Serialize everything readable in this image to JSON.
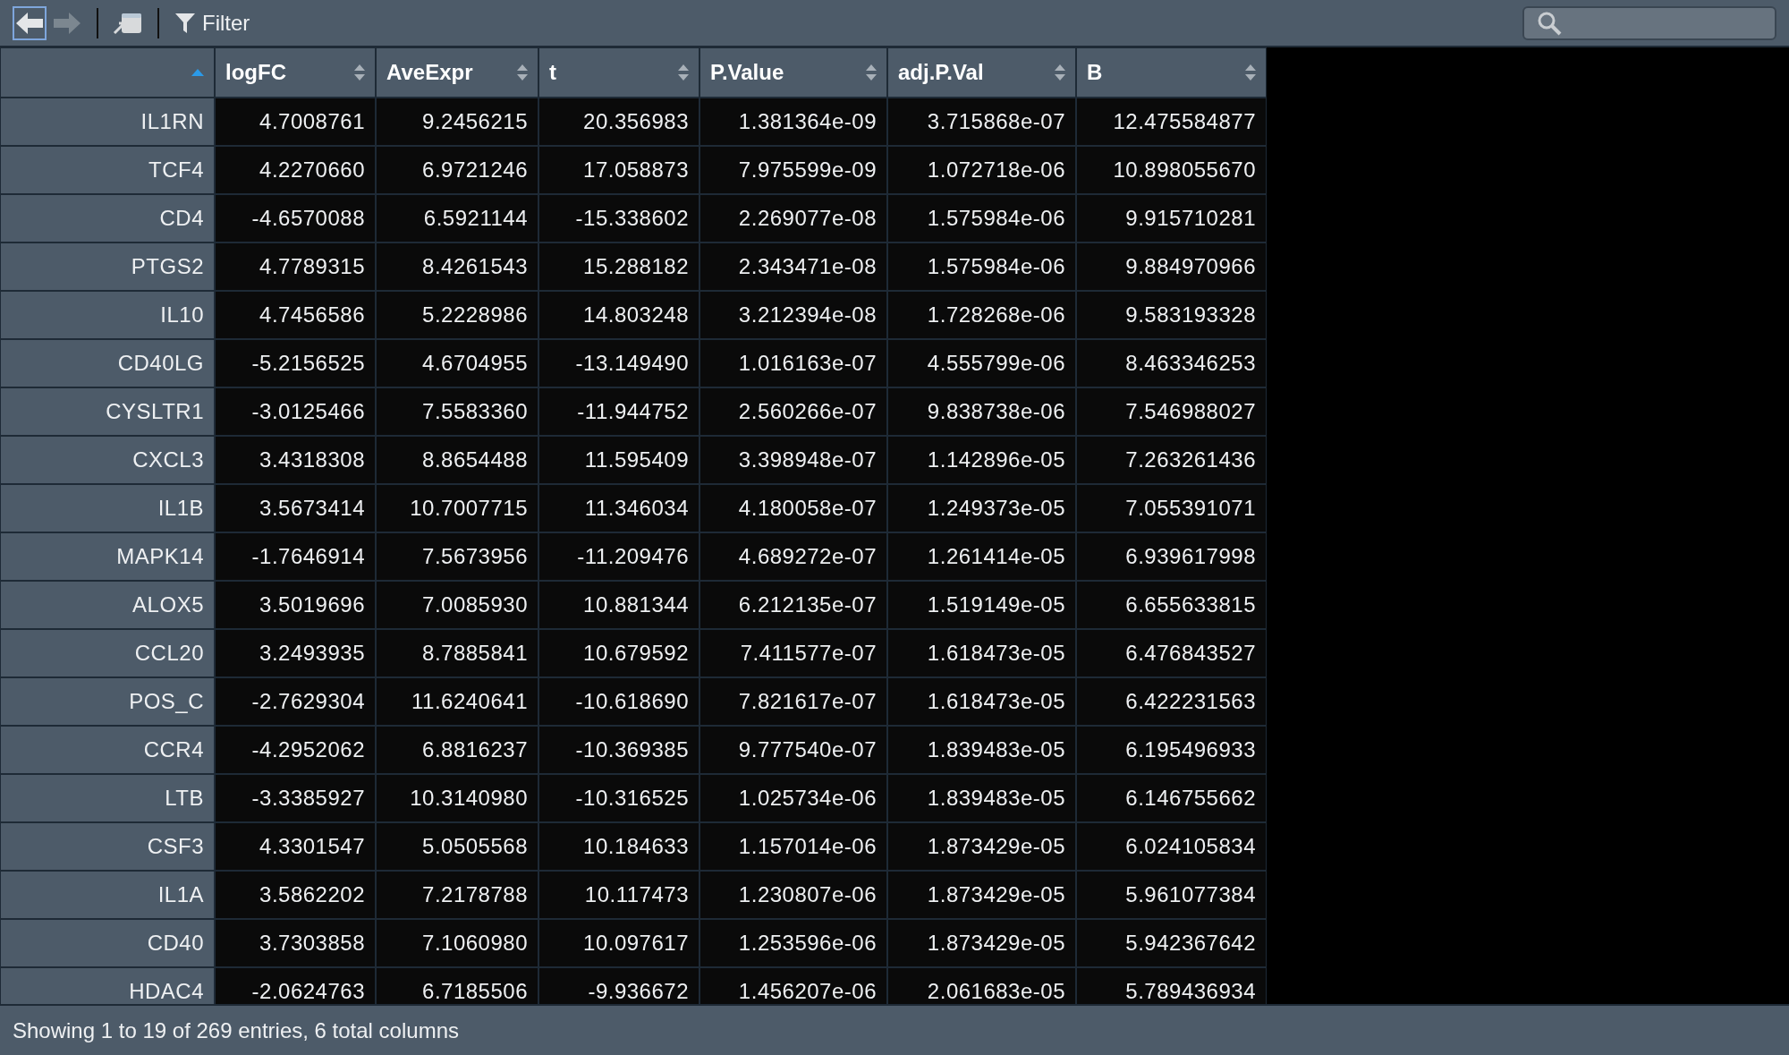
{
  "toolbar": {
    "back": {
      "disabled": false,
      "selected": true
    },
    "forward": {
      "disabled": true,
      "selected": false
    },
    "filter_label": "Filter"
  },
  "table": {
    "columns": [
      {
        "sorted": true
      },
      {
        "label": "logFC",
        "sorted": false
      },
      {
        "label": "AveExpr",
        "sorted": false
      },
      {
        "label": "t",
        "sorted": false
      },
      {
        "label": "P.Value",
        "sorted": false
      },
      {
        "label": "adj.P.Val",
        "sorted": false
      },
      {
        "label": "B",
        "sorted": false
      }
    ],
    "rows": [
      [
        "IL1RN",
        "4.7008761",
        "9.2456215",
        "20.356983",
        "1.381364e-09",
        "3.715868e-07",
        "12.475584877"
      ],
      [
        "TCF4",
        "4.2270660",
        "6.9721246",
        "17.058873",
        "7.975599e-09",
        "1.072718e-06",
        "10.898055670"
      ],
      [
        "CD4",
        "-4.6570088",
        "6.5921144",
        "-15.338602",
        "2.269077e-08",
        "1.575984e-06",
        "9.915710281"
      ],
      [
        "PTGS2",
        "4.7789315",
        "8.4261543",
        "15.288182",
        "2.343471e-08",
        "1.575984e-06",
        "9.884970966"
      ],
      [
        "IL10",
        "4.7456586",
        "5.2228986",
        "14.803248",
        "3.212394e-08",
        "1.728268e-06",
        "9.583193328"
      ],
      [
        "CD40LG",
        "-5.2156525",
        "4.6704955",
        "-13.149490",
        "1.016163e-07",
        "4.555799e-06",
        "8.463346253"
      ],
      [
        "CYSLTR1",
        "-3.0125466",
        "7.5583360",
        "-11.944752",
        "2.560266e-07",
        "9.838738e-06",
        "7.546988027"
      ],
      [
        "CXCL3",
        "3.4318308",
        "8.8654488",
        "11.595409",
        "3.398948e-07",
        "1.142896e-05",
        "7.263261436"
      ],
      [
        "IL1B",
        "3.5673414",
        "10.7007715",
        "11.346034",
        "4.180058e-07",
        "1.249373e-05",
        "7.055391071"
      ],
      [
        "MAPK14",
        "-1.7646914",
        "7.5673956",
        "-11.209476",
        "4.689272e-07",
        "1.261414e-05",
        "6.939617998"
      ],
      [
        "ALOX5",
        "3.5019696",
        "7.0085930",
        "10.881344",
        "6.212135e-07",
        "1.519149e-05",
        "6.655633815"
      ],
      [
        "CCL20",
        "3.2493935",
        "8.7885841",
        "10.679592",
        "7.411577e-07",
        "1.618473e-05",
        "6.476843527"
      ],
      [
        "POS_C",
        "-2.7629304",
        "11.6240641",
        "-10.618690",
        "7.821617e-07",
        "1.618473e-05",
        "6.422231563"
      ],
      [
        "CCR4",
        "-4.2952062",
        "6.8816237",
        "-10.369385",
        "9.777540e-07",
        "1.839483e-05",
        "6.195496933"
      ],
      [
        "LTB",
        "-3.3385927",
        "10.3140980",
        "-10.316525",
        "1.025734e-06",
        "1.839483e-05",
        "6.146755662"
      ],
      [
        "CSF3",
        "4.3301547",
        "5.0505568",
        "10.184633",
        "1.157014e-06",
        "1.873429e-05",
        "6.024105834"
      ],
      [
        "IL1A",
        "3.5862202",
        "7.2178788",
        "10.117473",
        "1.230807e-06",
        "1.873429e-05",
        "5.961077384"
      ],
      [
        "CD40",
        "3.7303858",
        "7.1060980",
        "10.097617",
        "1.253596e-06",
        "1.873429e-05",
        "5.942367642"
      ],
      [
        "HDAC4",
        "-2.0624763",
        "6.7185506",
        "-9.936672",
        "1.456207e-06",
        "2.061683e-05",
        "5.789436934"
      ]
    ]
  },
  "status_bar": "Showing 1 to 19 of 269 entries, 6 total columns"
}
